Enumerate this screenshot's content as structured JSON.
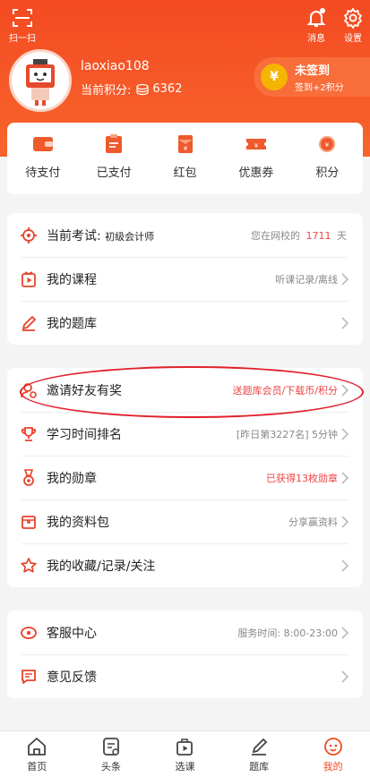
{
  "header": {
    "scan_label": "扫一扫",
    "message_label": "消息",
    "settings_label": "设置",
    "username": "laoxiao108",
    "points_label": "当前积分:",
    "points_value": "6362",
    "signin_title": "未签到",
    "signin_sub": "签到+2积分",
    "signin_coin_symbol": "¥"
  },
  "quick_actions": [
    {
      "label": "待支付",
      "icon": "wallet-icon"
    },
    {
      "label": "已支付",
      "icon": "clipboard-icon"
    },
    {
      "label": "红包",
      "icon": "red-envelope-icon"
    },
    {
      "label": "优惠券",
      "icon": "coupon-icon"
    },
    {
      "label": "积分",
      "icon": "coin-icon"
    }
  ],
  "card1": {
    "exam_label": "当前考试:",
    "exam_name": "初级会计师",
    "exam_days_prefix": "您在网校的",
    "exam_days": "1711",
    "exam_days_unit": "天",
    "courses_label": "我的课程",
    "courses_sub": "听课记录/离线",
    "questions_label": "我的题库"
  },
  "card2": {
    "invite_label": "邀请好友有奖",
    "invite_sub": "送题库会员/下载币/积分",
    "ranking_label": "学习时间排名",
    "ranking_sub": "[昨日第3227名] 5分钟",
    "medal_label": "我的勋章",
    "medal_sub": "已获得13枚勋章",
    "materials_label": "我的资料包",
    "materials_sub": "分享赢资料",
    "favorites_label": "我的收藏/记录/关注"
  },
  "card3": {
    "service_label": "客服中心",
    "service_sub": "服务时间: 8:00-23:00",
    "feedback_label": "意见反馈"
  },
  "tabs": [
    {
      "label": "首页",
      "icon": "home-icon"
    },
    {
      "label": "头条",
      "icon": "news-icon"
    },
    {
      "label": "选课",
      "icon": "course-bag-icon"
    },
    {
      "label": "题库",
      "icon": "pen-icon"
    },
    {
      "label": "我的",
      "icon": "profile-face-icon"
    }
  ],
  "colors": {
    "accent": "#f44a22",
    "highlight_red": "#e44444",
    "annotation_red": "#e0202a"
  }
}
